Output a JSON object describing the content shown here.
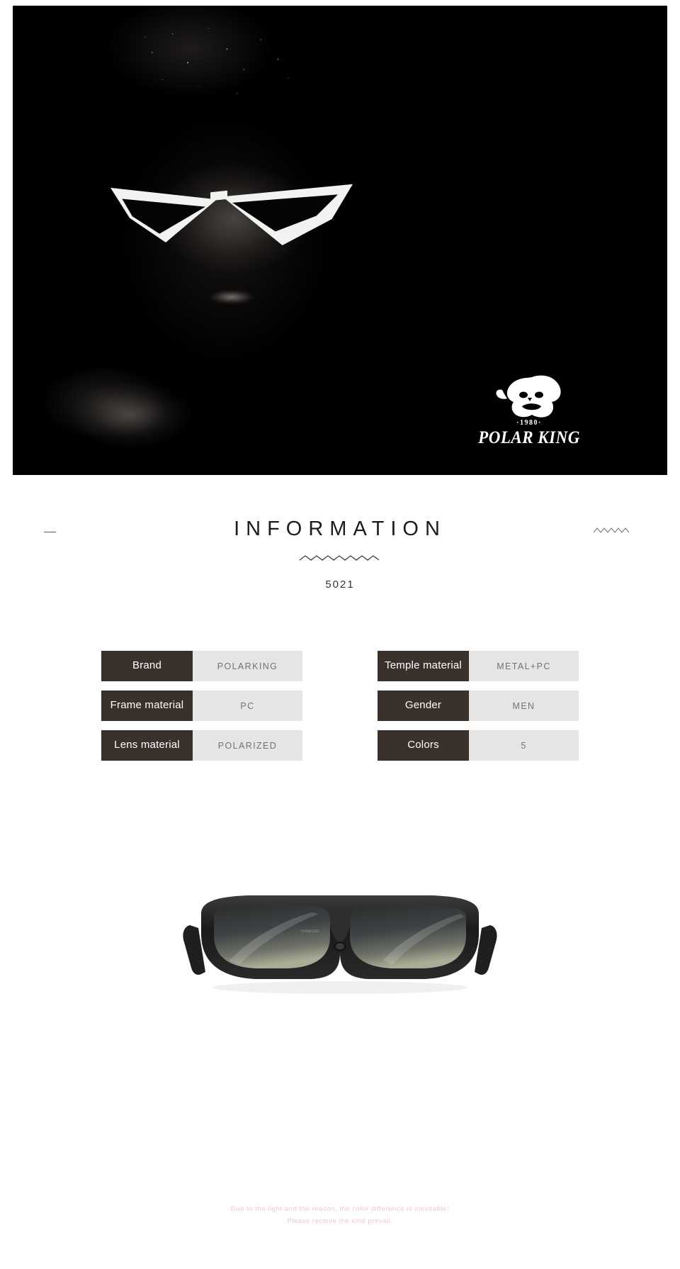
{
  "hero": {
    "alt_description": "Woman wearing white cat-eye sunglasses on black background",
    "brand": {
      "mark_icon": "gorilla-head-icon",
      "year": "·1980·",
      "name": "POLAR KING"
    }
  },
  "info": {
    "title": "INFORMATION",
    "left_dash_icon": "dash-icon",
    "right_zigzag_icon": "zigzag-icon",
    "center_zigzag_icon": "zigzag-icon",
    "model_number": "5021"
  },
  "specs": {
    "left_column": [
      {
        "label": "Brand",
        "value": "POLARKING"
      },
      {
        "label": "Frame material",
        "value": "PC"
      },
      {
        "label": "Lens material",
        "value": "POLARIZED"
      }
    ],
    "right_column": [
      {
        "label": "Temple material",
        "value": "METAL+PC"
      },
      {
        "label": "Gender",
        "value": "MEN"
      },
      {
        "label": "Colors",
        "value": "5"
      }
    ]
  },
  "product": {
    "alt_description": "Black square polarized sunglasses front view",
    "lens_marking": "Polarized"
  },
  "disclaimer": {
    "line1": "Due to the light and the reason, the color difference is inevitable!",
    "line2": "Please receive the kind prevail."
  },
  "colors": {
    "label_bg": "#3a302c",
    "value_bg": "#e6e5e3",
    "value_text": "#737373",
    "hero_bg": "#000000",
    "disclaimer_text": "#f0c8c8",
    "page_bg": "#ffffff"
  }
}
